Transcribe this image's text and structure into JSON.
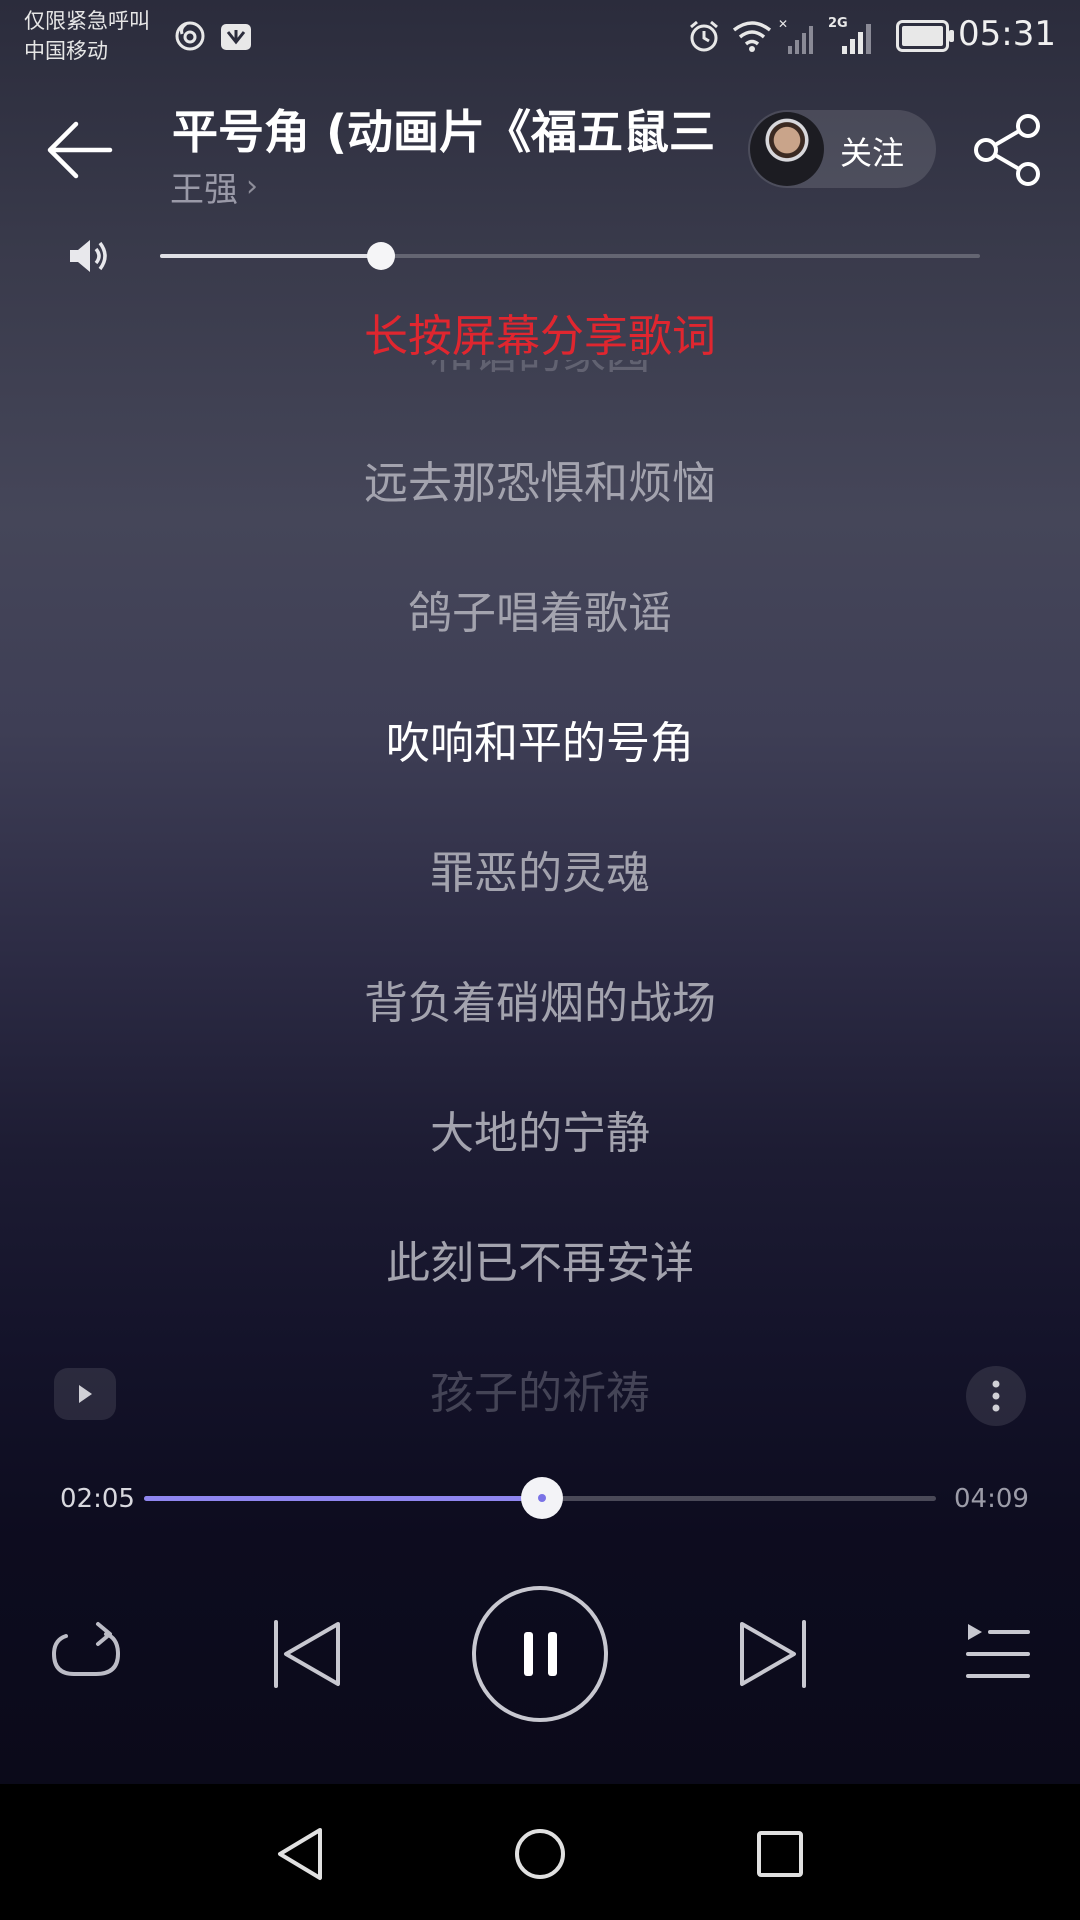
{
  "status_bar": {
    "carrier_line1": "仅限紧急呼叫",
    "carrier_line2": "中国移动",
    "network": "2G",
    "time": "05:31"
  },
  "header": {
    "song_title": "平号角 (动画片《福五鼠三",
    "artist": "王强",
    "follow_label": "关注"
  },
  "volume": {
    "level": 0.27
  },
  "lyrics": {
    "share_hint": "长按屏幕分享歌词",
    "lines": [
      "和谐的家园",
      "远去那恐惧和烦恼",
      "鸽子唱着歌谣",
      "吹响和平的号角",
      "罪恶的灵魂",
      "背负着硝烟的战场",
      "大地的宁静",
      "此刻已不再安详",
      "孩子的祈祷"
    ],
    "active_index": 3
  },
  "playback": {
    "current_time": "02:05",
    "total_time": "04:09",
    "progress": 0.502
  },
  "colors": {
    "accent": "#8f86f0",
    "hint_red": "#e0262f"
  }
}
